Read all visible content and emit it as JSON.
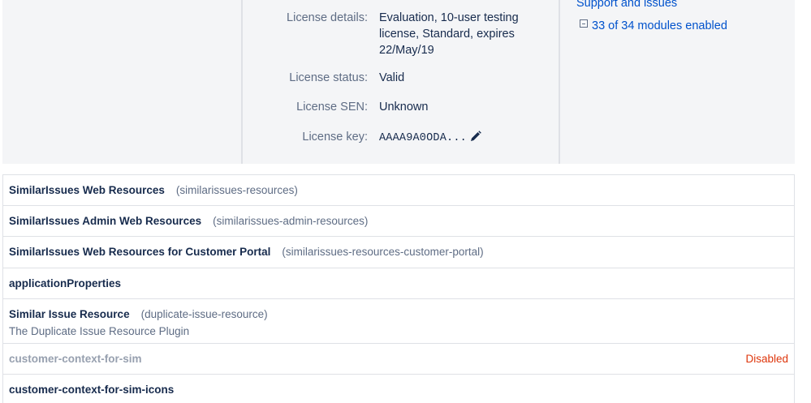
{
  "license": {
    "details_label": "License details:",
    "details_lines": [
      "Evaluation, 10-user testing",
      "license, Standard, expires",
      "22/May/19"
    ],
    "status_label": "License status:",
    "status_value": "Valid",
    "sen_label": "License SEN:",
    "sen_value": "Unknown",
    "key_label": "License key:",
    "key_value": "AAAA9A0ODA..."
  },
  "sidebar": {
    "support_link": "Support and issues",
    "modules_text": "33 of 34 modules enabled"
  },
  "modules": [
    {
      "name": "SimilarIssues Web Resources",
      "key": "(similarissues-resources)"
    },
    {
      "name": "SimilarIssues Admin Web Resources",
      "key": "(similarissues-admin-resources)"
    },
    {
      "name": "SimilarIssues Web Resources for Customer Portal",
      "key": "(similarissues-resources-customer-portal)"
    },
    {
      "name": "applicationProperties",
      "key": ""
    },
    {
      "name": "Similar Issue Resource",
      "key": "(duplicate-issue-resource)",
      "description": "The Duplicate Issue Resource Plugin"
    },
    {
      "name": "customer-context-for-sim",
      "key": "",
      "status": "Disabled"
    },
    {
      "name": "customer-context-for-sim-icons",
      "key": ""
    }
  ],
  "colors": {
    "link": "#0052cc",
    "disabled_status": "#de350b",
    "panel_bg": "#f4f5f7"
  }
}
